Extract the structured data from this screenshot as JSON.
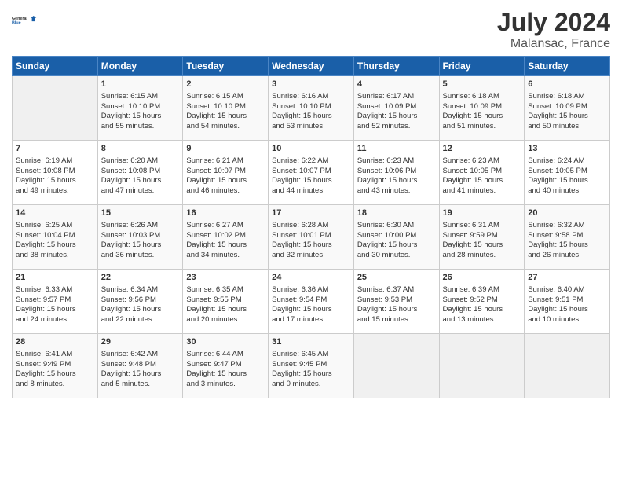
{
  "header": {
    "logo_line1": "General",
    "logo_line2": "Blue",
    "month_title": "July 2024",
    "subtitle": "Malansac, France"
  },
  "days_of_week": [
    "Sunday",
    "Monday",
    "Tuesday",
    "Wednesday",
    "Thursday",
    "Friday",
    "Saturday"
  ],
  "weeks": [
    [
      {
        "day": "",
        "content": ""
      },
      {
        "day": "1",
        "content": "Sunrise: 6:15 AM\nSunset: 10:10 PM\nDaylight: 15 hours\nand 55 minutes."
      },
      {
        "day": "2",
        "content": "Sunrise: 6:15 AM\nSunset: 10:10 PM\nDaylight: 15 hours\nand 54 minutes."
      },
      {
        "day": "3",
        "content": "Sunrise: 6:16 AM\nSunset: 10:10 PM\nDaylight: 15 hours\nand 53 minutes."
      },
      {
        "day": "4",
        "content": "Sunrise: 6:17 AM\nSunset: 10:09 PM\nDaylight: 15 hours\nand 52 minutes."
      },
      {
        "day": "5",
        "content": "Sunrise: 6:18 AM\nSunset: 10:09 PM\nDaylight: 15 hours\nand 51 minutes."
      },
      {
        "day": "6",
        "content": "Sunrise: 6:18 AM\nSunset: 10:09 PM\nDaylight: 15 hours\nand 50 minutes."
      }
    ],
    [
      {
        "day": "7",
        "content": "Sunrise: 6:19 AM\nSunset: 10:08 PM\nDaylight: 15 hours\nand 49 minutes."
      },
      {
        "day": "8",
        "content": "Sunrise: 6:20 AM\nSunset: 10:08 PM\nDaylight: 15 hours\nand 47 minutes."
      },
      {
        "day": "9",
        "content": "Sunrise: 6:21 AM\nSunset: 10:07 PM\nDaylight: 15 hours\nand 46 minutes."
      },
      {
        "day": "10",
        "content": "Sunrise: 6:22 AM\nSunset: 10:07 PM\nDaylight: 15 hours\nand 44 minutes."
      },
      {
        "day": "11",
        "content": "Sunrise: 6:23 AM\nSunset: 10:06 PM\nDaylight: 15 hours\nand 43 minutes."
      },
      {
        "day": "12",
        "content": "Sunrise: 6:23 AM\nSunset: 10:05 PM\nDaylight: 15 hours\nand 41 minutes."
      },
      {
        "day": "13",
        "content": "Sunrise: 6:24 AM\nSunset: 10:05 PM\nDaylight: 15 hours\nand 40 minutes."
      }
    ],
    [
      {
        "day": "14",
        "content": "Sunrise: 6:25 AM\nSunset: 10:04 PM\nDaylight: 15 hours\nand 38 minutes."
      },
      {
        "day": "15",
        "content": "Sunrise: 6:26 AM\nSunset: 10:03 PM\nDaylight: 15 hours\nand 36 minutes."
      },
      {
        "day": "16",
        "content": "Sunrise: 6:27 AM\nSunset: 10:02 PM\nDaylight: 15 hours\nand 34 minutes."
      },
      {
        "day": "17",
        "content": "Sunrise: 6:28 AM\nSunset: 10:01 PM\nDaylight: 15 hours\nand 32 minutes."
      },
      {
        "day": "18",
        "content": "Sunrise: 6:30 AM\nSunset: 10:00 PM\nDaylight: 15 hours\nand 30 minutes."
      },
      {
        "day": "19",
        "content": "Sunrise: 6:31 AM\nSunset: 9:59 PM\nDaylight: 15 hours\nand 28 minutes."
      },
      {
        "day": "20",
        "content": "Sunrise: 6:32 AM\nSunset: 9:58 PM\nDaylight: 15 hours\nand 26 minutes."
      }
    ],
    [
      {
        "day": "21",
        "content": "Sunrise: 6:33 AM\nSunset: 9:57 PM\nDaylight: 15 hours\nand 24 minutes."
      },
      {
        "day": "22",
        "content": "Sunrise: 6:34 AM\nSunset: 9:56 PM\nDaylight: 15 hours\nand 22 minutes."
      },
      {
        "day": "23",
        "content": "Sunrise: 6:35 AM\nSunset: 9:55 PM\nDaylight: 15 hours\nand 20 minutes."
      },
      {
        "day": "24",
        "content": "Sunrise: 6:36 AM\nSunset: 9:54 PM\nDaylight: 15 hours\nand 17 minutes."
      },
      {
        "day": "25",
        "content": "Sunrise: 6:37 AM\nSunset: 9:53 PM\nDaylight: 15 hours\nand 15 minutes."
      },
      {
        "day": "26",
        "content": "Sunrise: 6:39 AM\nSunset: 9:52 PM\nDaylight: 15 hours\nand 13 minutes."
      },
      {
        "day": "27",
        "content": "Sunrise: 6:40 AM\nSunset: 9:51 PM\nDaylight: 15 hours\nand 10 minutes."
      }
    ],
    [
      {
        "day": "28",
        "content": "Sunrise: 6:41 AM\nSunset: 9:49 PM\nDaylight: 15 hours\nand 8 minutes."
      },
      {
        "day": "29",
        "content": "Sunrise: 6:42 AM\nSunset: 9:48 PM\nDaylight: 15 hours\nand 5 minutes."
      },
      {
        "day": "30",
        "content": "Sunrise: 6:44 AM\nSunset: 9:47 PM\nDaylight: 15 hours\nand 3 minutes."
      },
      {
        "day": "31",
        "content": "Sunrise: 6:45 AM\nSunset: 9:45 PM\nDaylight: 15 hours\nand 0 minutes."
      },
      {
        "day": "",
        "content": ""
      },
      {
        "day": "",
        "content": ""
      },
      {
        "day": "",
        "content": ""
      }
    ]
  ]
}
